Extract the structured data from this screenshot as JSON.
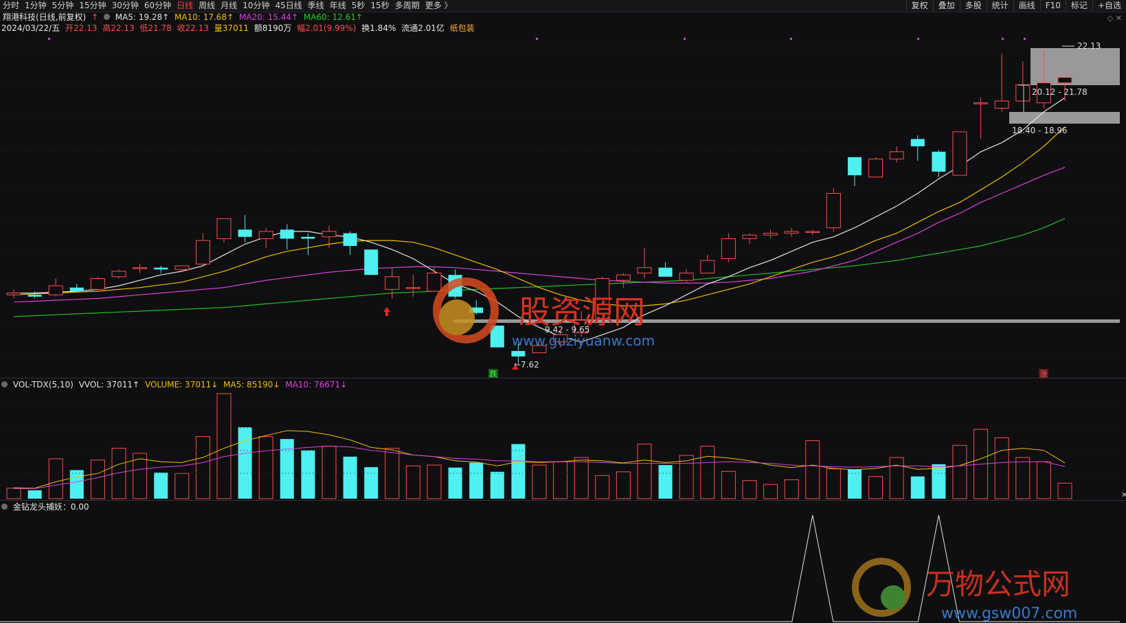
{
  "toolbar": {
    "periods": [
      "分时",
      "1分钟",
      "5分钟",
      "15分钟",
      "30分钟",
      "60分钟",
      "日线",
      "周线",
      "月线",
      "10分钟",
      "45日线",
      "季线",
      "年线",
      "5秒",
      "15秒",
      "多周期",
      "更多 〉"
    ],
    "active_period": "日线",
    "right_buttons": [
      "复权",
      "叠加",
      "多股",
      "统计",
      "画线",
      "F10",
      "标记",
      "+自选"
    ]
  },
  "header": {
    "stock": "翔港科技(日线,前复权)",
    "arrow": "↑",
    "ma5": "MA5: 19.28↑",
    "ma10": "MA10: 17.68↑",
    "ma20": "MA20: 15.44↑",
    "ma60": "MA60: 12.61↑",
    "date": "2024/03/22/五",
    "open": "开22.13",
    "high": "高22.13",
    "low": "低21.78",
    "close": "收22.13",
    "volume": "量37011",
    "amount": "额8190万",
    "range": "幅2.01(9.99%)",
    "turnover": "换1.84%",
    "float": "流通2.01亿",
    "sector": "纸包装"
  },
  "annotations": {
    "high_label": "22.13",
    "zone_upper": "20.12 - 21.78",
    "zone_mid": "18.40 - 18.96",
    "zone_low": "9.42 - 9.65",
    "low_label": "←7.62",
    "die": "跌",
    "zhang": "涨",
    "watermark1": "股资源网",
    "watermark1_url": "www.guziyuanw.com",
    "watermark2": "万物公式网",
    "watermark2_url": "www.gsw007.com"
  },
  "volume_panel": {
    "title": "VOL-TDX(5,10)",
    "vvol": "VVOL: 37011↑",
    "volume": "VOLUME: 37011↓",
    "ma5": "MA5: 85190↓",
    "ma10": "MA10: 76671↓"
  },
  "indicator_panel": {
    "title": "金钻龙头捕妖：0.00"
  },
  "colors": {
    "up": "#ff4d4d",
    "down": "#4ef0f0",
    "ma5": "#e6e6e6",
    "ma10": "#f0c000",
    "ma20": "#e040e0",
    "ma60": "#20c020"
  },
  "chart_data": {
    "type": "candlestick",
    "candles": [
      {
        "o": 8.4,
        "h": 8.7,
        "l": 8.2,
        "c": 8.5
      },
      {
        "o": 8.4,
        "h": 8.6,
        "l": 8.2,
        "c": 8.3
      },
      {
        "o": 8.4,
        "h": 9.3,
        "l": 8.3,
        "c": 8.9
      },
      {
        "o": 8.8,
        "h": 9.0,
        "l": 8.6,
        "c": 8.6
      },
      {
        "o": 8.7,
        "h": 9.4,
        "l": 8.6,
        "c": 9.3
      },
      {
        "o": 9.4,
        "h": 9.8,
        "l": 9.3,
        "c": 9.7
      },
      {
        "o": 9.9,
        "h": 10.1,
        "l": 9.6,
        "c": 9.9
      },
      {
        "o": 9.9,
        "h": 10.0,
        "l": 9.6,
        "c": 9.8
      },
      {
        "o": 9.8,
        "h": 10.0,
        "l": 9.7,
        "c": 10.0
      },
      {
        "o": 10.1,
        "h": 11.8,
        "l": 10.0,
        "c": 11.4
      },
      {
        "o": 11.5,
        "h": 12.6,
        "l": 11.3,
        "c": 12.6
      },
      {
        "o": 12.0,
        "h": 12.8,
        "l": 11.3,
        "c": 11.6
      },
      {
        "o": 11.5,
        "h": 12.1,
        "l": 11.0,
        "c": 11.9
      },
      {
        "o": 12.0,
        "h": 12.3,
        "l": 10.9,
        "c": 11.5
      },
      {
        "o": 11.6,
        "h": 11.8,
        "l": 10.6,
        "c": 11.5
      },
      {
        "o": 11.6,
        "h": 12.2,
        "l": 11.0,
        "c": 11.9
      },
      {
        "o": 11.8,
        "h": 11.9,
        "l": 10.6,
        "c": 11.1
      },
      {
        "o": 10.9,
        "h": 10.9,
        "l": 9.5,
        "c": 9.5
      },
      {
        "o": 8.7,
        "h": 9.9,
        "l": 8.2,
        "c": 9.4
      },
      {
        "o": 8.8,
        "h": 9.5,
        "l": 8.3,
        "c": 8.8
      },
      {
        "o": 8.6,
        "h": 9.9,
        "l": 8.6,
        "c": 9.6
      },
      {
        "o": 9.5,
        "h": 9.8,
        "l": 8.2,
        "c": 8.3
      },
      {
        "o": 7.7,
        "h": 8.1,
        "l": 7.3,
        "c": 7.4
      },
      {
        "o": 6.7,
        "h": 6.7,
        "l": 5.5,
        "c": 5.5
      },
      {
        "o": 5.3,
        "h": 5.7,
        "l": 4.6,
        "c": 5.0
      },
      {
        "o": 5.2,
        "h": 5.7,
        "l": 5.2,
        "c": 5.6
      },
      {
        "o": 5.8,
        "h": 6.4,
        "l": 5.5,
        "c": 6.2
      },
      {
        "o": 6.3,
        "h": 7.5,
        "l": 6.1,
        "c": 7.0
      },
      {
        "o": 7.1,
        "h": 9.4,
        "l": 6.9,
        "c": 9.3
      },
      {
        "o": 9.2,
        "h": 9.6,
        "l": 8.8,
        "c": 9.5
      },
      {
        "o": 9.6,
        "h": 11.0,
        "l": 9.3,
        "c": 9.9
      },
      {
        "o": 9.9,
        "h": 10.2,
        "l": 9.4,
        "c": 9.4
      },
      {
        "o": 9.2,
        "h": 9.8,
        "l": 9.1,
        "c": 9.6
      },
      {
        "o": 9.6,
        "h": 10.6,
        "l": 9.6,
        "c": 10.3
      },
      {
        "o": 10.4,
        "h": 11.8,
        "l": 10.2,
        "c": 11.5
      },
      {
        "o": 11.5,
        "h": 11.8,
        "l": 11.2,
        "c": 11.7
      },
      {
        "o": 11.7,
        "h": 12.0,
        "l": 11.5,
        "c": 11.8
      },
      {
        "o": 11.8,
        "h": 12.1,
        "l": 11.6,
        "c": 11.9
      },
      {
        "o": 11.9,
        "h": 12.0,
        "l": 11.7,
        "c": 11.9
      },
      {
        "o": 12.1,
        "h": 14.3,
        "l": 11.9,
        "c": 14.0
      },
      {
        "o": 16.0,
        "h": 16.0,
        "l": 14.4,
        "c": 15.0
      },
      {
        "o": 14.9,
        "h": 16.0,
        "l": 14.9,
        "c": 15.9
      },
      {
        "o": 15.9,
        "h": 16.6,
        "l": 15.7,
        "c": 16.3
      },
      {
        "o": 17.0,
        "h": 17.2,
        "l": 15.8,
        "c": 16.6
      },
      {
        "o": 16.3,
        "h": 16.4,
        "l": 14.9,
        "c": 15.2
      },
      {
        "o": 15.0,
        "h": 17.4,
        "l": 15.0,
        "c": 17.4
      },
      {
        "o": 19.0,
        "h": 19.3,
        "l": 17.0,
        "c": 19.0
      },
      {
        "o": 18.7,
        "h": 21.7,
        "l": 18.5,
        "c": 19.1
      },
      {
        "o": 19.1,
        "h": 21.3,
        "l": 19.1,
        "c": 20.0
      },
      {
        "o": 19.0,
        "h": 21.9,
        "l": 18.7,
        "c": 20.1
      },
      {
        "o": 20.1,
        "h": 20.4,
        "l": 19.1,
        "c": 20.4
      }
    ],
    "ma5": [
      8.5,
      8.5,
      8.55,
      8.6,
      8.7,
      8.9,
      9.2,
      9.5,
      9.7,
      10.0,
      10.6,
      11.2,
      11.6,
      11.9,
      11.9,
      11.7,
      11.6,
      11.3,
      10.9,
      10.4,
      9.7,
      9.0,
      8.6,
      8.0,
      7.2,
      6.6,
      6.1,
      5.8,
      6.2,
      6.6,
      7.3,
      7.8,
      8.4,
      9.0,
      9.4,
      9.9,
      10.3,
      10.8,
      11.3,
      11.6,
      12.1,
      12.7,
      13.3,
      14.0,
      14.8,
      15.5,
      16.3,
      16.8,
      17.5,
      18.5,
      19.28
    ],
    "ma10": [
      8.4,
      8.45,
      8.5,
      8.55,
      8.6,
      8.7,
      8.8,
      8.95,
      9.1,
      9.4,
      9.7,
      10.1,
      10.5,
      10.8,
      11.0,
      11.2,
      11.35,
      11.4,
      11.4,
      11.3,
      11.0,
      10.6,
      10.2,
      9.8,
      9.3,
      8.8,
      8.4,
      8.1,
      7.9,
      7.8,
      7.8,
      7.9,
      8.1,
      8.4,
      8.7,
      9.0,
      9.4,
      9.8,
      10.2,
      10.5,
      10.9,
      11.4,
      11.8,
      12.4,
      13.0,
      13.5,
      14.2,
      14.9,
      15.7,
      16.6,
      17.68
    ],
    "ma20": [
      8.0,
      8.05,
      8.1,
      8.15,
      8.2,
      8.3,
      8.4,
      8.5,
      8.6,
      8.7,
      8.8,
      9.0,
      9.2,
      9.35,
      9.5,
      9.65,
      9.75,
      9.85,
      9.9,
      9.95,
      9.95,
      9.9,
      9.8,
      9.7,
      9.6,
      9.5,
      9.4,
      9.3,
      9.2,
      9.15,
      9.1,
      9.05,
      9.05,
      9.05,
      9.1,
      9.2,
      9.3,
      9.5,
      9.7,
      10.0,
      10.3,
      10.8,
      11.3,
      11.8,
      12.4,
      12.9,
      13.5,
      14.0,
      14.5,
      15.0,
      15.44
    ],
    "ma60": [
      7.2,
      7.25,
      7.3,
      7.35,
      7.4,
      7.45,
      7.5,
      7.55,
      7.6,
      7.65,
      7.7,
      7.8,
      7.9,
      8.0,
      8.1,
      8.2,
      8.3,
      8.4,
      8.5,
      8.55,
      8.6,
      8.65,
      8.7,
      8.75,
      8.8,
      8.85,
      8.9,
      8.95,
      9.0,
      9.05,
      9.1,
      9.15,
      9.2,
      9.3,
      9.4,
      9.5,
      9.6,
      9.7,
      9.8,
      9.9,
      10.0,
      10.15,
      10.3,
      10.5,
      10.7,
      10.9,
      11.1,
      11.4,
      11.7,
      12.1,
      12.61
    ],
    "volumes": [
      25000,
      20000,
      95000,
      68000,
      92000,
      120000,
      108000,
      62000,
      60000,
      148000,
      250000,
      170000,
      148000,
      142000,
      115000,
      125000,
      100000,
      75000,
      120000,
      78000,
      80000,
      74000,
      86000,
      64000,
      130000,
      80000,
      88000,
      98000,
      55000,
      64000,
      130000,
      80000,
      103000,
      125000,
      65000,
      43000,
      34000,
      45000,
      138000,
      71000,
      70000,
      53000,
      98000,
      53000,
      82000,
      127000,
      165000,
      145000,
      98000,
      88000,
      37011
    ],
    "vol_ma5": [
      26000,
      25000,
      40000,
      52000,
      60000,
      82000,
      95000,
      88000,
      86000,
      98000,
      120000,
      138000,
      150000,
      162000,
      160000,
      152000,
      140000,
      122000,
      116000,
      104000,
      100000,
      90000,
      87000,
      78000,
      88000,
      86000,
      88000,
      92000,
      90000,
      85000,
      92000,
      86000,
      90000,
      101000,
      97000,
      90000,
      80000,
      74000,
      80000,
      72000,
      69000,
      72000,
      80000,
      70000,
      72000,
      79000,
      95000,
      115000,
      120000,
      115000,
      85190
    ],
    "vol_ma10": [
      24000,
      24000,
      32000,
      40000,
      50000,
      62000,
      70000,
      75000,
      78000,
      86000,
      100000,
      108000,
      114000,
      118000,
      122000,
      125000,
      123000,
      115000,
      110000,
      104000,
      100000,
      96000,
      94000,
      90000,
      90000,
      88000,
      88000,
      88000,
      86000,
      84000,
      84000,
      84000,
      84000,
      86000,
      88000,
      86000,
      84000,
      80000,
      78000,
      76000,
      75000,
      76000,
      78000,
      78000,
      76000,
      78000,
      82000,
      86000,
      88000,
      88000,
      76671
    ],
    "indicator": [
      0,
      0,
      0,
      0,
      0,
      0,
      0,
      0,
      0,
      0,
      0,
      0,
      0,
      0,
      0,
      0,
      0,
      0,
      0,
      0,
      0,
      0,
      0,
      0,
      0,
      0,
      0,
      0,
      0,
      0,
      0,
      0,
      0,
      0,
      0,
      0,
      0,
      0,
      1,
      0,
      0,
      0,
      0,
      0,
      1,
      0,
      0,
      0,
      0,
      0,
      0
    ]
  }
}
